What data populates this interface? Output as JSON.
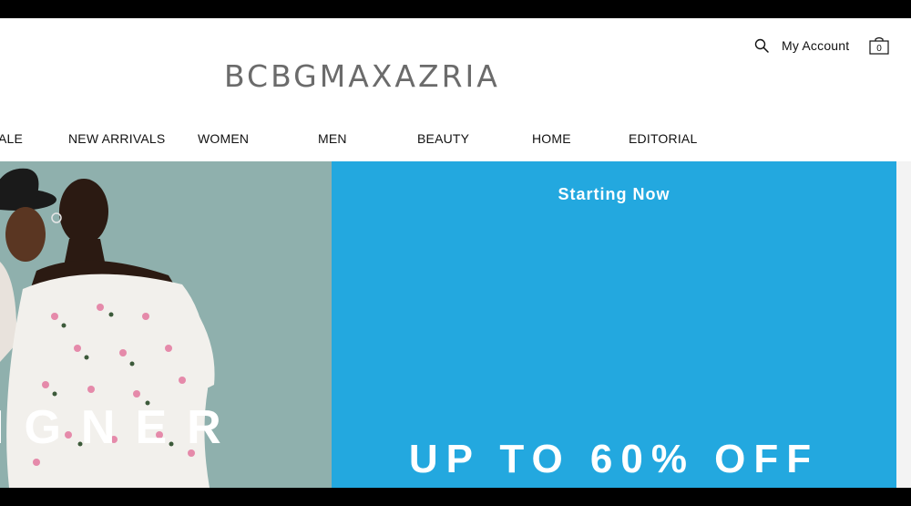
{
  "header": {
    "logo": "BCBGMAXAZRIA",
    "account_label": "My Account",
    "bag_count": "0",
    "search_icon": "search-icon",
    "bag_icon": "shopping-bag-icon"
  },
  "nav": {
    "items": [
      {
        "label": "ALE"
      },
      {
        "label": "NEW ARRIVALS"
      },
      {
        "label": "WOMEN"
      },
      {
        "label": "MEN"
      },
      {
        "label": "BEAUTY"
      },
      {
        "label": "HOME"
      },
      {
        "label": "EDITORIAL"
      }
    ]
  },
  "hero": {
    "eyebrow": "Starting Now",
    "headline": "UP TO 60% OFF",
    "left_overlay_text": "IGNER"
  },
  "colors": {
    "brand_gray": "#6b6b6b",
    "hero_blue": "#23a8df",
    "hero_left_bg": "#8fb0ad"
  }
}
